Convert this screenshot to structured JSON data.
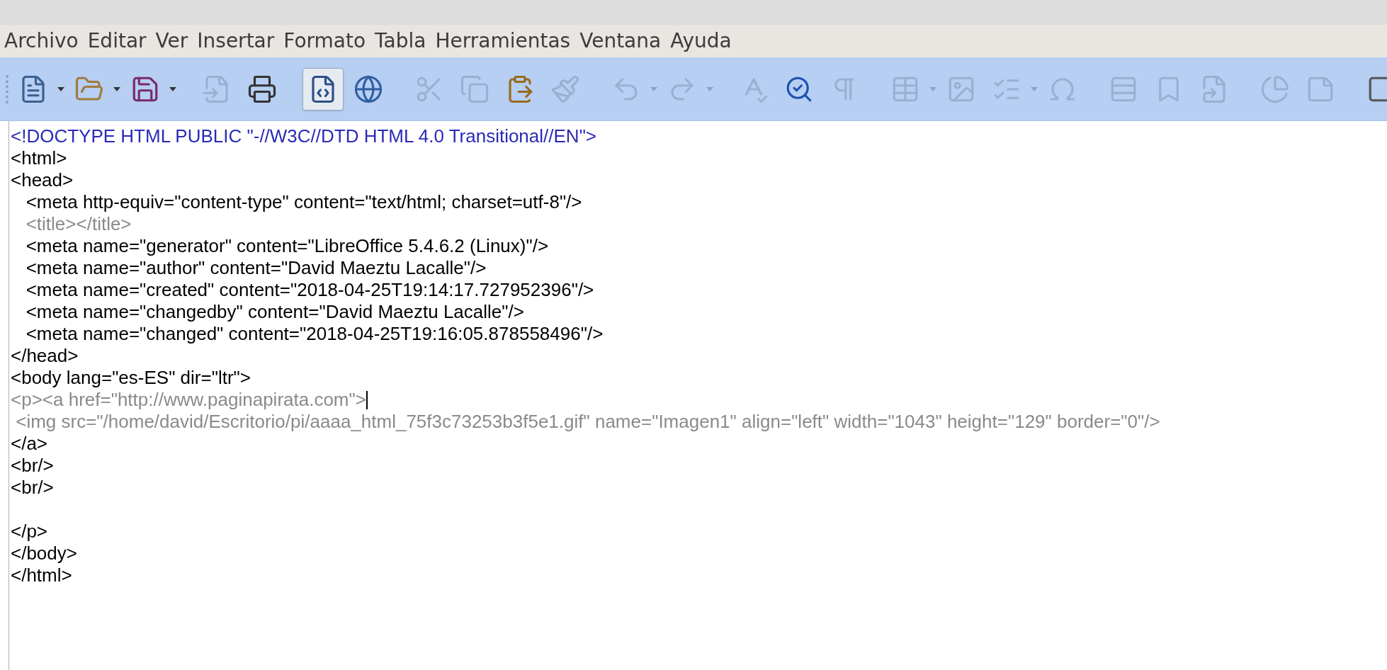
{
  "menu": [
    "Archivo",
    "Editar",
    "Ver",
    "Insertar",
    "Formato",
    "Tabla",
    "Herramientas",
    "Ventana",
    "Ayuda"
  ],
  "toolbar": [
    {
      "kind": "button",
      "disabled": false,
      "dropdown": true,
      "selected": false
    },
    {
      "kind": "button",
      "disabled": false,
      "dropdown": true,
      "selected": false
    },
    {
      "kind": "button",
      "disabled": false,
      "dropdown": true,
      "selected": false
    },
    {
      "kind": "separator"
    },
    {
      "kind": "button",
      "disabled": true,
      "dropdown": false,
      "selected": false
    },
    {
      "kind": "button",
      "disabled": false,
      "dropdown": false,
      "selected": false
    },
    {
      "kind": "separator"
    },
    {
      "kind": "button",
      "disabled": false,
      "dropdown": false,
      "selected": true
    },
    {
      "kind": "button",
      "disabled": false,
      "dropdown": false,
      "selected": false
    },
    {
      "kind": "separator"
    },
    {
      "kind": "button",
      "disabled": true,
      "dropdown": false,
      "selected": false
    },
    {
      "kind": "button",
      "disabled": true,
      "dropdown": false,
      "selected": false
    },
    {
      "kind": "button",
      "disabled": false,
      "dropdown": false,
      "selected": false
    },
    {
      "kind": "button",
      "disabled": true,
      "dropdown": false,
      "selected": false
    },
    {
      "kind": "separator"
    },
    {
      "kind": "button",
      "disabled": true,
      "dropdown": true,
      "selected": false
    },
    {
      "kind": "button",
      "disabled": true,
      "dropdown": true,
      "selected": false
    },
    {
      "kind": "separator"
    },
    {
      "kind": "button",
      "disabled": true,
      "dropdown": false,
      "selected": false
    },
    {
      "kind": "button",
      "disabled": false,
      "dropdown": false,
      "selected": false
    },
    {
      "kind": "button",
      "disabled": true,
      "dropdown": false,
      "selected": false
    },
    {
      "kind": "separator"
    },
    {
      "kind": "button",
      "disabled": true,
      "dropdown": true,
      "selected": false
    },
    {
      "kind": "button",
      "disabled": true,
      "dropdown": false,
      "selected": false
    },
    {
      "kind": "button",
      "disabled": true,
      "dropdown": true,
      "selected": false
    },
    {
      "kind": "button",
      "disabled": true,
      "dropdown": false,
      "selected": false
    },
    {
      "kind": "separator"
    },
    {
      "kind": "button",
      "disabled": true,
      "dropdown": false,
      "selected": false
    },
    {
      "kind": "button",
      "disabled": true,
      "dropdown": false,
      "selected": false
    },
    {
      "kind": "button",
      "disabled": true,
      "dropdown": false,
      "selected": false
    },
    {
      "kind": "separator"
    },
    {
      "kind": "button",
      "disabled": true,
      "dropdown": false,
      "selected": false
    },
    {
      "kind": "button",
      "disabled": true,
      "dropdown": false,
      "selected": false
    },
    {
      "kind": "separator"
    },
    {
      "kind": "button",
      "disabled": false,
      "dropdown": false,
      "selected": false
    }
  ],
  "code_lines": [
    {
      "kind": "doctype",
      "text": "<!DOCTYPE HTML PUBLIC \"-//W3C//DTD HTML 4.0 Transitional//EN\">",
      "cursor": false
    },
    {
      "kind": "tag",
      "text": "<html>",
      "cursor": false
    },
    {
      "kind": "tag",
      "text": "<head>",
      "cursor": false
    },
    {
      "kind": "tag",
      "text": "   <meta http-equiv=\"content-type\" content=\"text/html; charset=utf-8\"/>",
      "cursor": false
    },
    {
      "kind": "muted",
      "text": "   <title></title>",
      "cursor": false
    },
    {
      "kind": "tag",
      "text": "   <meta name=\"generator\" content=\"LibreOffice 5.4.6.2 (Linux)\"/>",
      "cursor": false
    },
    {
      "kind": "tag",
      "text": "   <meta name=\"author\" content=\"David Maeztu Lacalle\"/>",
      "cursor": false
    },
    {
      "kind": "tag",
      "text": "   <meta name=\"created\" content=\"2018-04-25T19:14:17.727952396\"/>",
      "cursor": false
    },
    {
      "kind": "tag",
      "text": "   <meta name=\"changedby\" content=\"David Maeztu Lacalle\"/>",
      "cursor": false
    },
    {
      "kind": "tag",
      "text": "   <meta name=\"changed\" content=\"2018-04-25T19:16:05.878558496\"/>",
      "cursor": false
    },
    {
      "kind": "tag",
      "text": "</head>",
      "cursor": false
    },
    {
      "kind": "tag",
      "text": "<body lang=\"es-ES\" dir=\"ltr\">",
      "cursor": false
    },
    {
      "kind": "muted",
      "text": "<p><a href=\"http://www.paginapirata.com\">",
      "cursor": true
    },
    {
      "kind": "muted",
      "text": " <img src=\"/home/david/Escritorio/pi/aaaa_html_75f3c73253b3f5e1.gif\" name=\"Imagen1\" align=\"left\" width=\"1043\" height=\"129\" border=\"0\"/>",
      "cursor": false
    },
    {
      "kind": "tag",
      "text": "</a>",
      "cursor": false
    },
    {
      "kind": "tag",
      "text": "<br/>",
      "cursor": false
    },
    {
      "kind": "tag",
      "text": "<br/>",
      "cursor": false
    },
    {
      "kind": "blank",
      "cursor": false
    },
    {
      "kind": "tag",
      "text": "</p>",
      "cursor": false
    },
    {
      "kind": "tag",
      "text": "</body>",
      "cursor": false
    },
    {
      "kind": "tag",
      "text": "</html>",
      "cursor": false
    }
  ]
}
